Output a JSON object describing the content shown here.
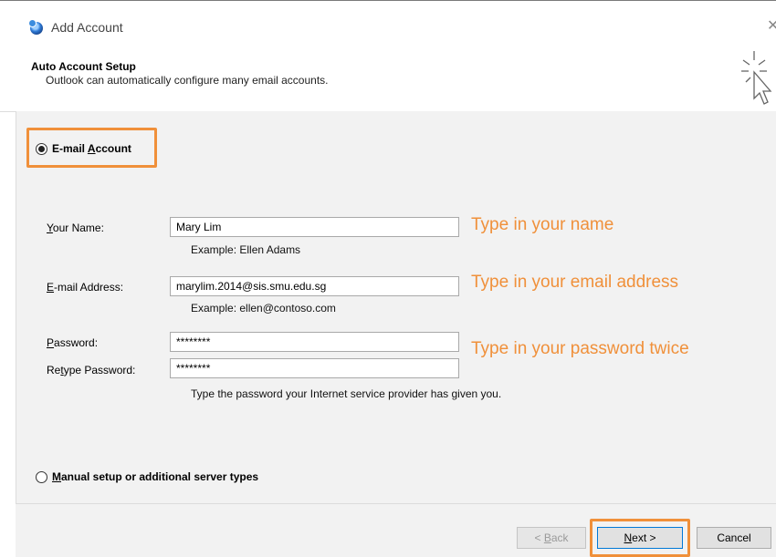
{
  "window": {
    "title": "Add Account"
  },
  "header": {
    "title": "Auto Account Setup",
    "subtitle": "Outlook can automatically configure many email accounts."
  },
  "options": {
    "email_account": {
      "pre": "E-mail ",
      "underline": "A",
      "post": "ccount",
      "selected": true
    },
    "manual": {
      "pre": "",
      "underline": "M",
      "post": "anual setup or additional server types",
      "selected": false
    }
  },
  "form": {
    "name": {
      "label_u": "Y",
      "label_rest": "our Name:",
      "value": "Mary Lim",
      "example": "Example: Ellen Adams"
    },
    "email": {
      "label_u": "E",
      "label_rest": "-mail Address:",
      "value": "marylim.2014@sis.smu.edu.sg",
      "example": "Example: ellen@contoso.com"
    },
    "password": {
      "label_u": "P",
      "label_rest": "assword:",
      "value": "********"
    },
    "retype": {
      "label_pre": "Re",
      "label_u": "t",
      "label_rest": "ype Password:",
      "value": "********"
    },
    "password_hint": "Type the password your Internet service provider has given you."
  },
  "annotations": {
    "name": "Type in your name",
    "email": "Type in your email address",
    "password": "Type in your password twice"
  },
  "buttons": {
    "back": {
      "pre": "< ",
      "underline": "B",
      "post": "ack"
    },
    "next": {
      "pre": "",
      "underline": "N",
      "post": "ext >"
    },
    "cancel": "Cancel"
  },
  "colors": {
    "highlight": "#f0903a",
    "content_bg": "#f2f2f2"
  }
}
